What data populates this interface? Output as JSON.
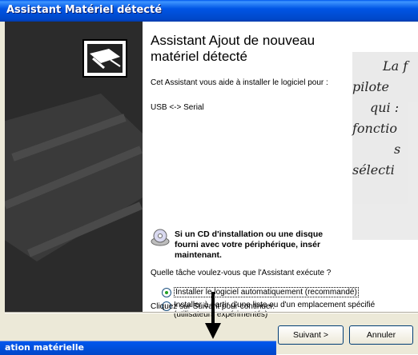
{
  "window": {
    "title": "Assistant Matériel détecté"
  },
  "wizard": {
    "heading_line1": "Assistant Ajout de nouveau",
    "heading_line2": "matériel détecté",
    "intro": "Cet Assistant vous aide à installer le logiciel pour :",
    "device": "USB <-> Serial",
    "cd_line1": "Si un CD d'installation ou une disque",
    "cd_line2": "fourni avec votre périphérique, insér",
    "cd_line3": "maintenant.",
    "question": "Quelle tâche voulez-vous que l'Assistant exécute ?",
    "option_auto": "Installer le logiciel automatiquement (recommandé)",
    "option_list_line1": "Installer à partir d'une liste ou d'un emplacement spécifié",
    "option_list_line2": "(utilisateurs expérimentés)",
    "continue_text": "Cliquez sur Suivant pour continuer."
  },
  "buttons": {
    "next": "Suivant >",
    "cancel": "Annuler"
  },
  "overlay_text": {
    "line1": "La f",
    "line2": "pilote",
    "line3": "qui :",
    "line4": "fonctio",
    "line5": "s",
    "line6": "sélecti"
  },
  "second_window": {
    "title": "ation matérielle"
  }
}
